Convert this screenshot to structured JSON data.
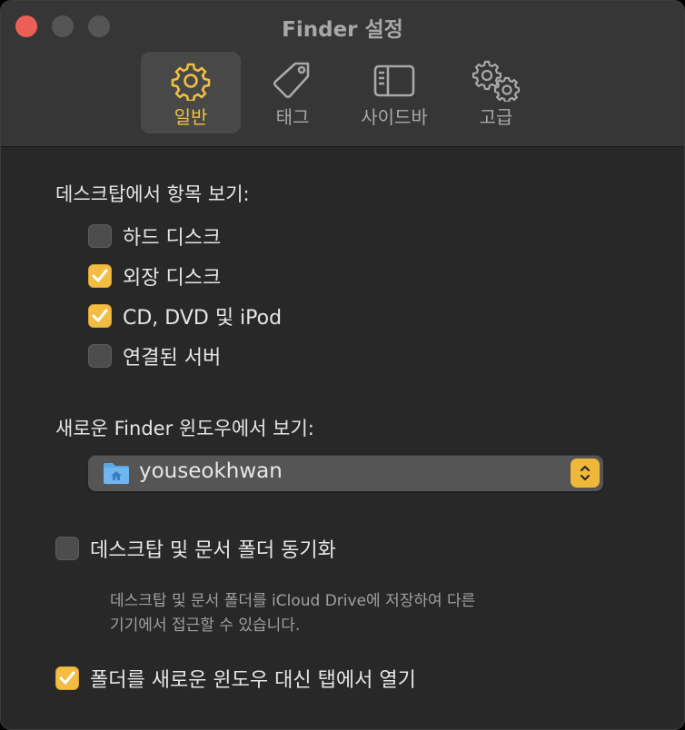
{
  "window": {
    "title": "Finder 설정"
  },
  "tabs": [
    {
      "label": "일반",
      "icon": "gear-icon",
      "selected": true
    },
    {
      "label": "태그",
      "icon": "tag-icon",
      "selected": false
    },
    {
      "label": "사이드바",
      "icon": "sidebar-icon",
      "selected": false
    },
    {
      "label": "고급",
      "icon": "gears-icon",
      "selected": false
    }
  ],
  "desktop_section": {
    "label": "데스크탑에서 항목 보기:",
    "items": [
      {
        "label": "하드 디스크",
        "checked": false
      },
      {
        "label": "외장 디스크",
        "checked": true
      },
      {
        "label": "CD, DVD 및 iPod",
        "checked": true
      },
      {
        "label": "연결된 서버",
        "checked": false
      }
    ]
  },
  "new_window": {
    "label": "새로운 Finder 윈도우에서 보기:",
    "value": "youseokhwan",
    "icon": "home-folder-icon"
  },
  "sync": {
    "label": "데스크탑 및 문서 폴더 동기화",
    "checked": false,
    "note_line1": "데스크탑 및 문서 폴더를 iCloud Drive에 저장하여 다른",
    "note_line2": "기기에서 접근할 수 있습니다."
  },
  "open_in_tabs": {
    "label": "폴더를 새로운 윈도우 대신 탭에서 열기",
    "checked": true
  },
  "colors": {
    "accent": "#f3bd43",
    "background": "#282828",
    "toolbar": "#363636",
    "close_button": "#ec5f56"
  }
}
